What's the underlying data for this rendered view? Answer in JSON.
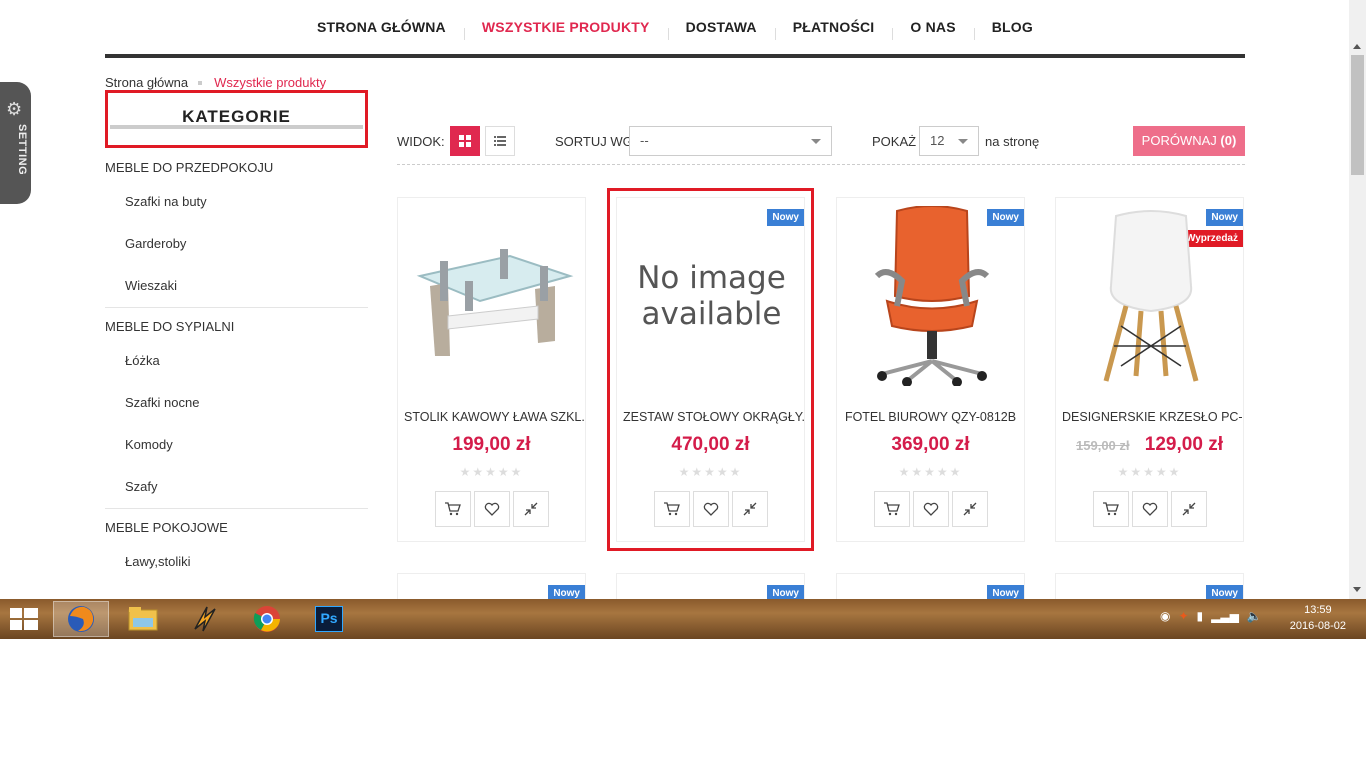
{
  "nav": {
    "items": [
      {
        "label": "STRONA GŁÓWNA",
        "active": false
      },
      {
        "label": "WSZYSTKIE PRODUKTY",
        "active": true
      },
      {
        "label": "DOSTAWA",
        "active": false
      },
      {
        "label": "PŁATNOŚCI",
        "active": false
      },
      {
        "label": "O NAS",
        "active": false
      },
      {
        "label": "BLOG",
        "active": false
      }
    ]
  },
  "setting_tab": {
    "label": "SETTING",
    "icon": "gear-icon"
  },
  "breadcrumb": {
    "home": "Strona główna",
    "current": "Wszystkie produkty"
  },
  "sidebar": {
    "title": "KATEGORIE",
    "groups": [
      {
        "label": "MEBLE DO PRZEDPOKOJU",
        "items": [
          "Szafki na buty",
          "Garderoby",
          "Wieszaki"
        ]
      },
      {
        "label": "MEBLE DO SYPIALNI",
        "items": [
          "Łóżka",
          "Szafki nocne",
          "Komody",
          "Szafy"
        ]
      },
      {
        "label": "MEBLE POKOJOWE",
        "items": [
          "Ławy,stoliki"
        ]
      }
    ]
  },
  "toolbar": {
    "view_label": "WIDOK:",
    "sort_label": "SORTUJ WG",
    "sort_value": "--",
    "show_label": "POKAŻ",
    "show_value": "12",
    "per_page_label": "na stronę",
    "compare_label": "PORÓWNAJ",
    "compare_count": "(0)"
  },
  "products": [
    {
      "name": "STOLIK KAWOWY ŁAWA SZKL...",
      "price": "199,00 zł",
      "old_price": "",
      "badges": []
    },
    {
      "name": "ZESTAW STOŁOWY OKRĄGŁY...",
      "price": "470,00 zł",
      "old_price": "",
      "badges": [
        "Nowy"
      ],
      "image_text": "No image available"
    },
    {
      "name": "FOTEL BIUROWY QZY-0812B",
      "price": "369,00 zł",
      "old_price": "",
      "badges": [
        "Nowy"
      ]
    },
    {
      "name": "DESIGNERSKIE KRZESŁO PC-...",
      "price": "129,00 zł",
      "old_price": "159,00 zł",
      "badges": [
        "Nowy",
        "Wyprzedaż"
      ]
    }
  ],
  "second_row_badges": [
    "Nowy",
    "Nowy",
    "Nowy",
    "Nowy"
  ],
  "taskbar": {
    "time": "13:59",
    "date": "2016-08-02",
    "apps": [
      "firefox-icon",
      "file-explorer-icon",
      "winamp-icon",
      "chrome-icon",
      "photoshop-icon"
    ],
    "photoshop_label": "Ps"
  },
  "colors": {
    "accent": "#e0284f",
    "badge_new": "#3a7fd5",
    "badge_sale": "#e01a25",
    "highlight_box": "#e01a25"
  }
}
